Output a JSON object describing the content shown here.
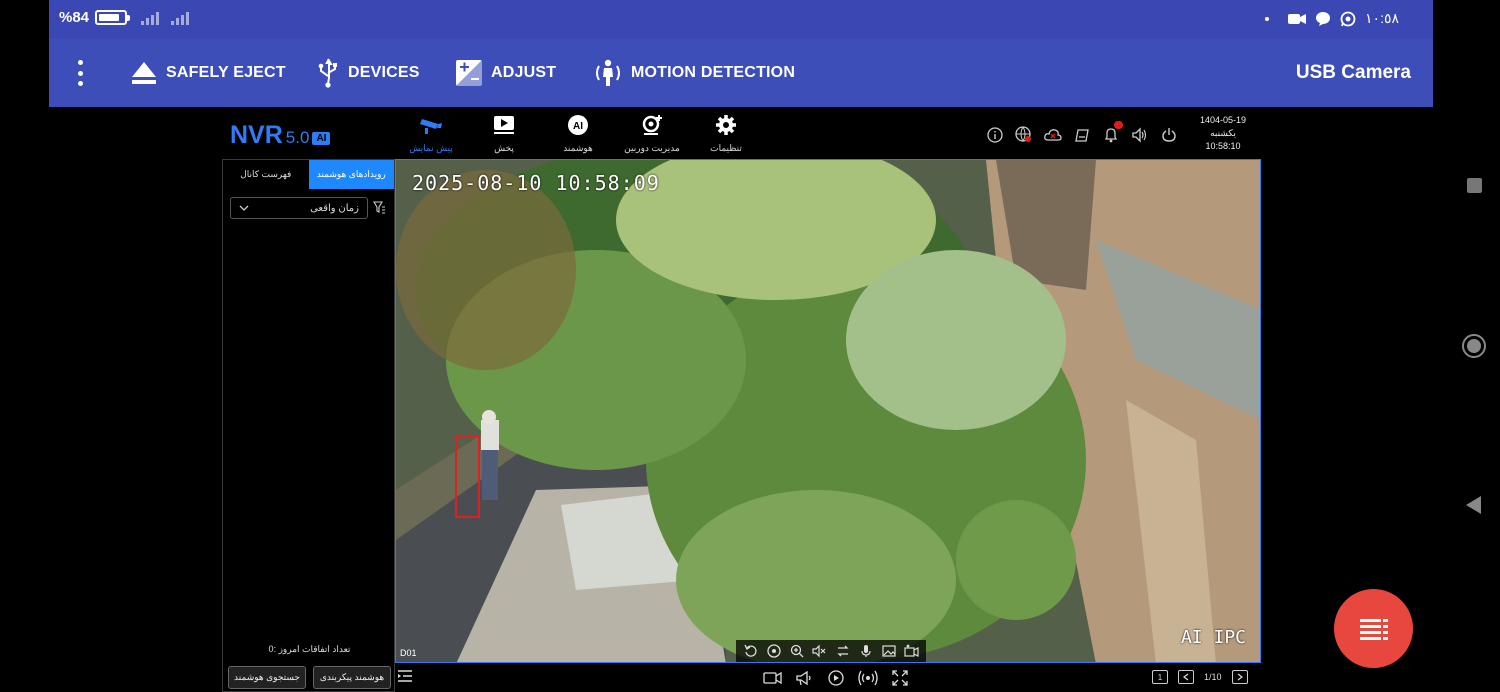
{
  "status_bar": {
    "battery_label": "%84",
    "battery_level": 0.84,
    "clock": "١٠:٥٨"
  },
  "toolbar": {
    "safely_eject_label": "SAFELY EJECT",
    "devices_label": "DEVICES",
    "adjust_label": "ADJUST",
    "motion_detection_label": "MOTION DETECTION",
    "title": "USB Camera"
  },
  "nvr": {
    "logo_text": "NVR",
    "logo_version": "5.0",
    "logo_badge": "AI",
    "nav_tabs": [
      {
        "label": "پیش نمایش",
        "icon": "camera-icon",
        "active": true
      },
      {
        "label": "پخش",
        "icon": "playback-icon",
        "active": false
      },
      {
        "label": "هوشمند",
        "icon": "ai-icon",
        "active": false
      },
      {
        "label": "مدیریت دوربین",
        "icon": "camera-add-icon",
        "active": false
      },
      {
        "label": "تنظیمات",
        "icon": "gear-icon",
        "active": false
      }
    ],
    "date": "1404-05-19",
    "weekday": "یکشنبه",
    "time": "10:58:10"
  },
  "panel": {
    "tab_events": "رویدادهای هوشمند",
    "tab_channels": "فهرست کانال",
    "mode_select": "زمان واقعی",
    "today_count_label": "تعداد اتفاقات امروز : ",
    "today_count_value": "0",
    "smart_search_button": "جستجوی هوشمند",
    "smart_config_button": "هوشمند پیکربندی"
  },
  "video": {
    "timestamp": "2025-08-10 10:58:09",
    "watermark": "AI IPC",
    "channel": "D01"
  },
  "pager": {
    "page_text": "1/10",
    "layout_label": "1"
  },
  "accent_colors": {
    "status_bar": "#3b48b3",
    "toolbar": "#3d4eb8",
    "nvr_accent": "#2e7cf6",
    "fab": "#e8473d",
    "detection_box": "#e02020"
  }
}
